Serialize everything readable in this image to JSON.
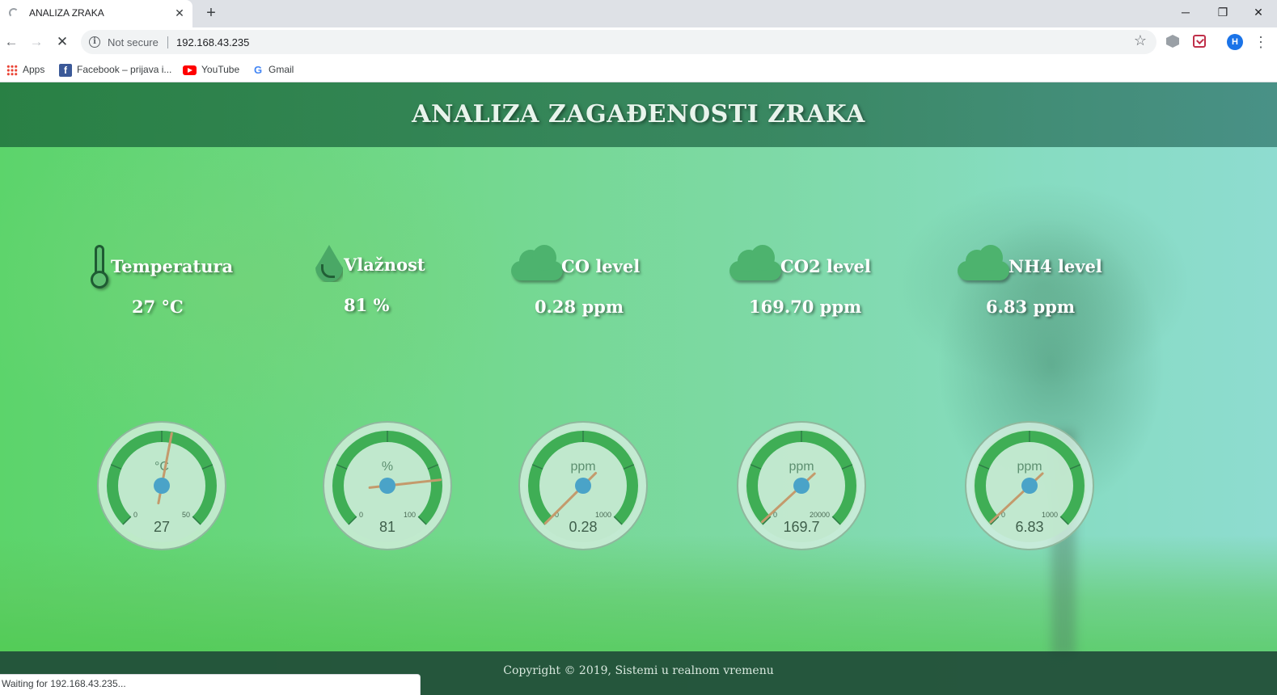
{
  "browser": {
    "tab_title": "ANALIZA ZRAKA",
    "tab_close": "✕",
    "new_tab": "+",
    "window_controls": {
      "minimize": "─",
      "restore": "❐",
      "close": "✕"
    },
    "nav": {
      "back": "←",
      "forward": "→",
      "stop": "✕"
    },
    "security_label": "Not secure",
    "url": "192.168.43.235",
    "bookmarks": [
      {
        "label": "Apps",
        "icon": "apps-grid-icon"
      },
      {
        "label": "Facebook – prijava i...",
        "icon": "facebook-icon"
      },
      {
        "label": "YouTube",
        "icon": "youtube-icon"
      },
      {
        "label": "Gmail",
        "icon": "google-icon"
      }
    ],
    "profile_initial": "H",
    "status_text": "Waiting for 192.168.43.235..."
  },
  "page": {
    "title": "ANALIZA ZAGAĐENOSTI ZRAKA",
    "footer": "Copyright © 2019, Sistemi u realnom vremenu",
    "sensors": [
      {
        "label": "Temperatura",
        "value_text": "27 °C",
        "icon": "thermometer-icon"
      },
      {
        "label": "Vlažnost",
        "value_text": "81 %",
        "icon": "water-drop-icon"
      },
      {
        "label": "CO level",
        "value_text": "0.28 ppm",
        "icon": "cloud-icon"
      },
      {
        "label": "CO2 level",
        "value_text": "169.70 ppm",
        "icon": "cloud-icon"
      },
      {
        "label": "NH4 level",
        "value_text": "6.83 ppm",
        "icon": "cloud-icon"
      }
    ],
    "gauges": [
      {
        "unit": "°C",
        "min": "0",
        "max": "50",
        "value": 27,
        "value_text": "27"
      },
      {
        "unit": "%",
        "min": "0",
        "max": "100",
        "value": 81,
        "value_text": "81"
      },
      {
        "unit": "ppm",
        "min": "0",
        "max": "1000",
        "value": 0.28,
        "value_text": "0.28"
      },
      {
        "unit": "ppm",
        "min": "0",
        "max": "20000",
        "value": 169.7,
        "value_text": "169.7"
      },
      {
        "unit": "ppm",
        "min": "0",
        "max": "1000",
        "value": 6.83,
        "value_text": "6.83"
      }
    ],
    "colors": {
      "gauge_arc": "#3fae55",
      "gauge_face": "#bfe8cc",
      "needle": "#c49a6c",
      "needle_hub": "#4aa3c8"
    }
  }
}
